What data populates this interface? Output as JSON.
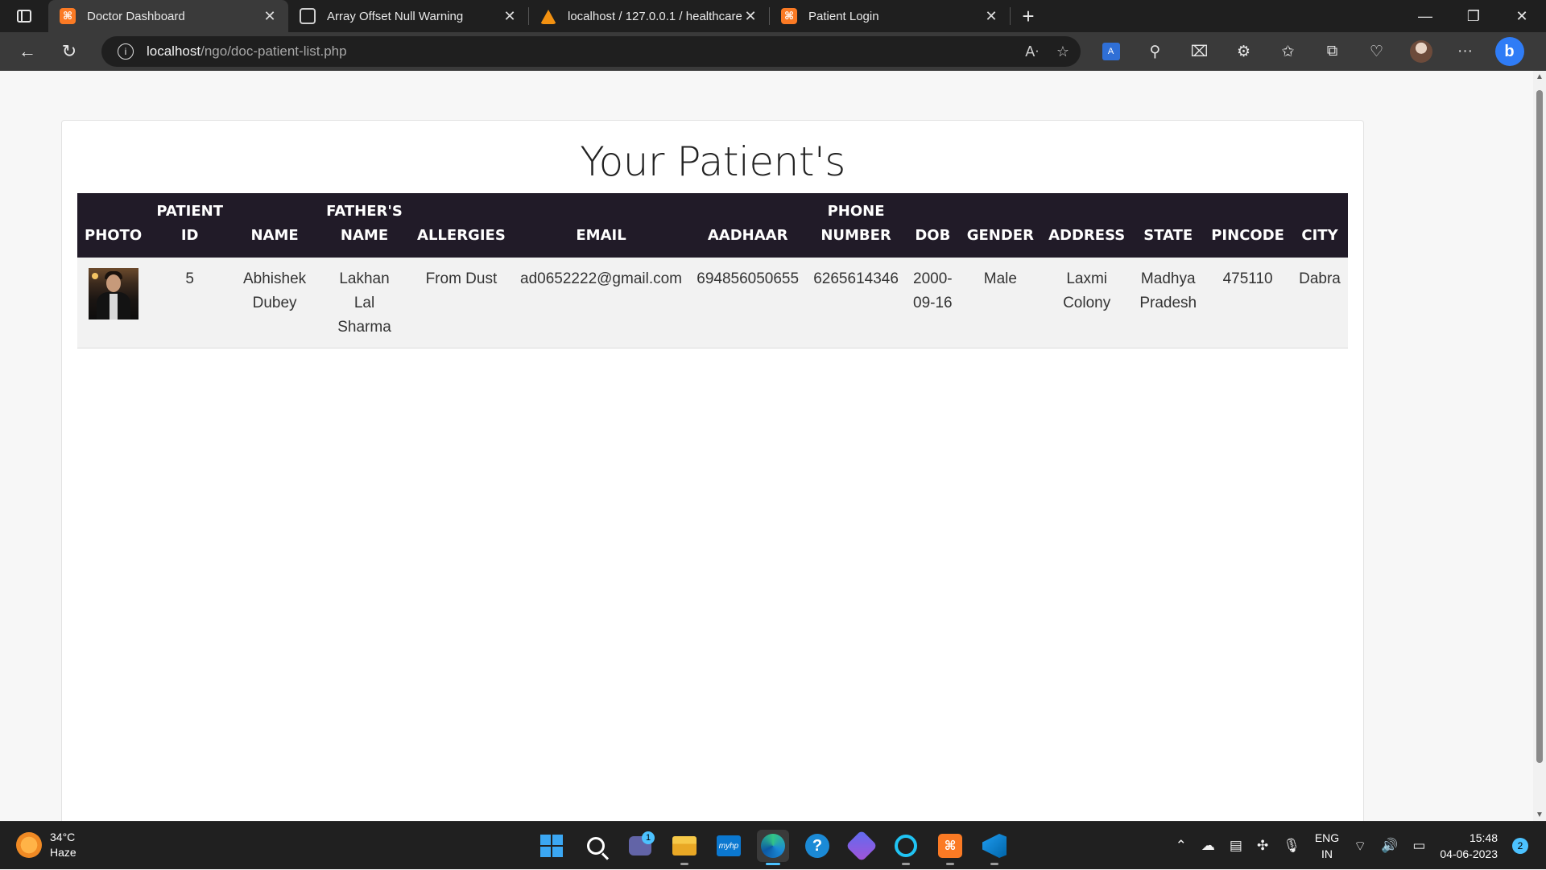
{
  "browser": {
    "tabs": [
      {
        "title": "Doctor Dashboard",
        "icon": "xampp-icon",
        "active": true
      },
      {
        "title": "Array Offset Null Warning",
        "icon": "chatgpt-icon",
        "active": false
      },
      {
        "title": "localhost / 127.0.0.1 / healthcare",
        "icon": "phpmyadmin-icon",
        "active": false
      },
      {
        "title": "Patient Login",
        "icon": "xampp-icon",
        "active": false
      }
    ],
    "address": {
      "host": "localhost",
      "path": "/ngo/doc-patient-list.php"
    }
  },
  "page": {
    "title": "Your Patient's",
    "table": {
      "headers": [
        {
          "line1": "",
          "line2": "PHOTO"
        },
        {
          "line1": "PATIENT",
          "line2": "ID"
        },
        {
          "line1": "",
          "line2": "NAME"
        },
        {
          "line1": "FATHER'S",
          "line2": "NAME"
        },
        {
          "line1": "",
          "line2": "ALLERGIES"
        },
        {
          "line1": "",
          "line2": "EMAIL"
        },
        {
          "line1": "",
          "line2": "AADHAAR"
        },
        {
          "line1": "PHONE",
          "line2": "NUMBER"
        },
        {
          "line1": "",
          "line2": "DOB"
        },
        {
          "line1": "",
          "line2": "GENDER"
        },
        {
          "line1": "",
          "line2": "ADDRESS"
        },
        {
          "line1": "",
          "line2": "STATE"
        },
        {
          "line1": "",
          "line2": "PINCODE"
        },
        {
          "line1": "",
          "line2": "CITY"
        }
      ],
      "rows": [
        {
          "patient_id": "5",
          "name": [
            "Abhishek",
            "Dubey"
          ],
          "father_name": [
            "Lakhan",
            "Lal",
            "Sharma"
          ],
          "allergies": "From Dust",
          "email": "ad0652222@gmail.com",
          "aadhaar": "694856050655",
          "phone": "6265614346",
          "dob": [
            "2000-",
            "09-16"
          ],
          "gender": "Male",
          "address": [
            "Laxmi",
            "Colony"
          ],
          "state": [
            "Madhya",
            "Pradesh"
          ],
          "pincode": "475110",
          "city": "Dabra"
        }
      ]
    }
  },
  "taskbar": {
    "weather": {
      "temp": "34°C",
      "condition": "Haze"
    },
    "teams_badge": "1",
    "edge_label": "myhp",
    "xampp_label": "⌘",
    "language": {
      "line1": "ENG",
      "line2": "IN"
    },
    "clock": {
      "time": "15:48",
      "date": "04-06-2023"
    },
    "notifications": "2"
  }
}
